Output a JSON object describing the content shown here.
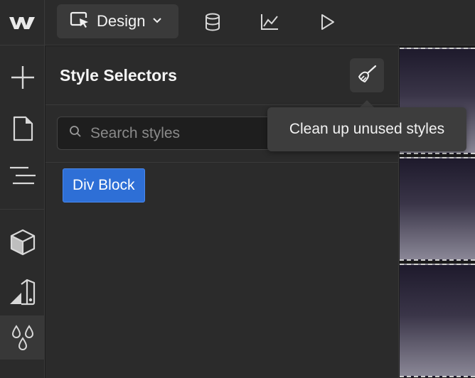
{
  "topbar": {
    "logo_icon": "webflow-logo-icon",
    "mode_label": "Design",
    "icons": [
      "database-icon",
      "analytics-icon",
      "play-icon"
    ]
  },
  "rail": {
    "icons": [
      "add-icon",
      "page-icon",
      "navigator-icon",
      "components-icon",
      "assets-icon",
      "styles-icon"
    ]
  },
  "panel": {
    "title": "Style Selectors",
    "cleanup_tooltip": "Clean up unused styles",
    "search": {
      "placeholder": "Search styles",
      "value": ""
    },
    "selectors": [
      "Div Block"
    ]
  },
  "colors": {
    "accent": "#2e6fd6",
    "panel_bg": "#2b2b2b",
    "input_bg": "#1e1e1e"
  }
}
